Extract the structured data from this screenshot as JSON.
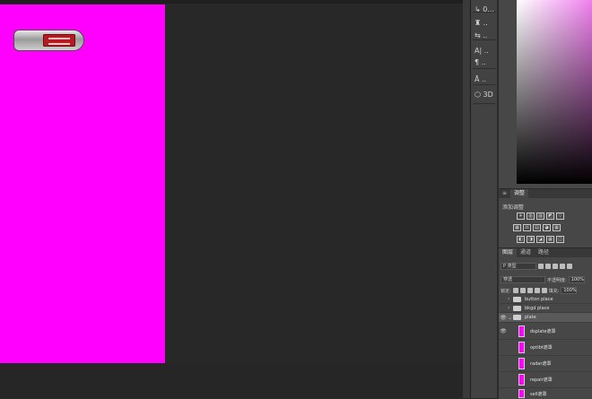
{
  "colors": {
    "canvas_fill": "#ff00ff",
    "workspace": "#282828",
    "panel": "#474747"
  },
  "tools": {
    "items": [
      {
        "label": "↳ 0...",
        "icon": "history-icon"
      },
      {
        "label": "♜ ..",
        "icon": "brush-settings-icon"
      },
      {
        "label": "⇆ ..",
        "icon": "clone-source-icon"
      },
      {
        "label": "A| ..",
        "icon": "character-icon"
      },
      {
        "label": "¶ ..",
        "icon": "paragraph-icon"
      },
      {
        "label": "Ā ..",
        "icon": "glyphs-icon"
      },
      {
        "label": "⬡ 3D",
        "icon": "3d-icon"
      }
    ]
  },
  "adjustments": {
    "tabs": [
      {
        "label": "≡"
      },
      {
        "label": "调整"
      }
    ],
    "heading": "添加调整",
    "row1": [
      "☀",
      "▥",
      "▨",
      "◩",
      "▽"
    ],
    "row2": [
      "▦",
      "⚖",
      "▤",
      "◕",
      "▦"
    ],
    "row3": [
      "◧",
      "◨",
      "◪",
      "▦",
      "◫"
    ]
  },
  "layers": {
    "tabs": [
      {
        "label": "图层"
      },
      {
        "label": "通道"
      },
      {
        "label": "路径"
      }
    ],
    "filter": {
      "kind": "P 类型"
    },
    "blend": {
      "mode": "穿透",
      "opacity_label": "不透明度:",
      "opacity_value": "100%"
    },
    "lock": {
      "label": "锁定:",
      "fill_label": "填充:",
      "fill_value": "100%"
    },
    "items": [
      {
        "name": "button place",
        "type": "group",
        "visible": false
      },
      {
        "name": "bkgd place",
        "type": "group",
        "visible": false
      },
      {
        "name": "plate",
        "type": "group",
        "visible": true
      },
      {
        "name": "dsplate遮罩",
        "type": "layer",
        "visible": true
      },
      {
        "name": "optibt遮罩",
        "type": "layer",
        "visible": false
      },
      {
        "name": "radar遮罩",
        "type": "layer",
        "visible": false
      },
      {
        "name": "repair遮罩",
        "type": "layer",
        "visible": false
      },
      {
        "name": "sell遮罩",
        "type": "layer",
        "visible": false
      }
    ]
  }
}
